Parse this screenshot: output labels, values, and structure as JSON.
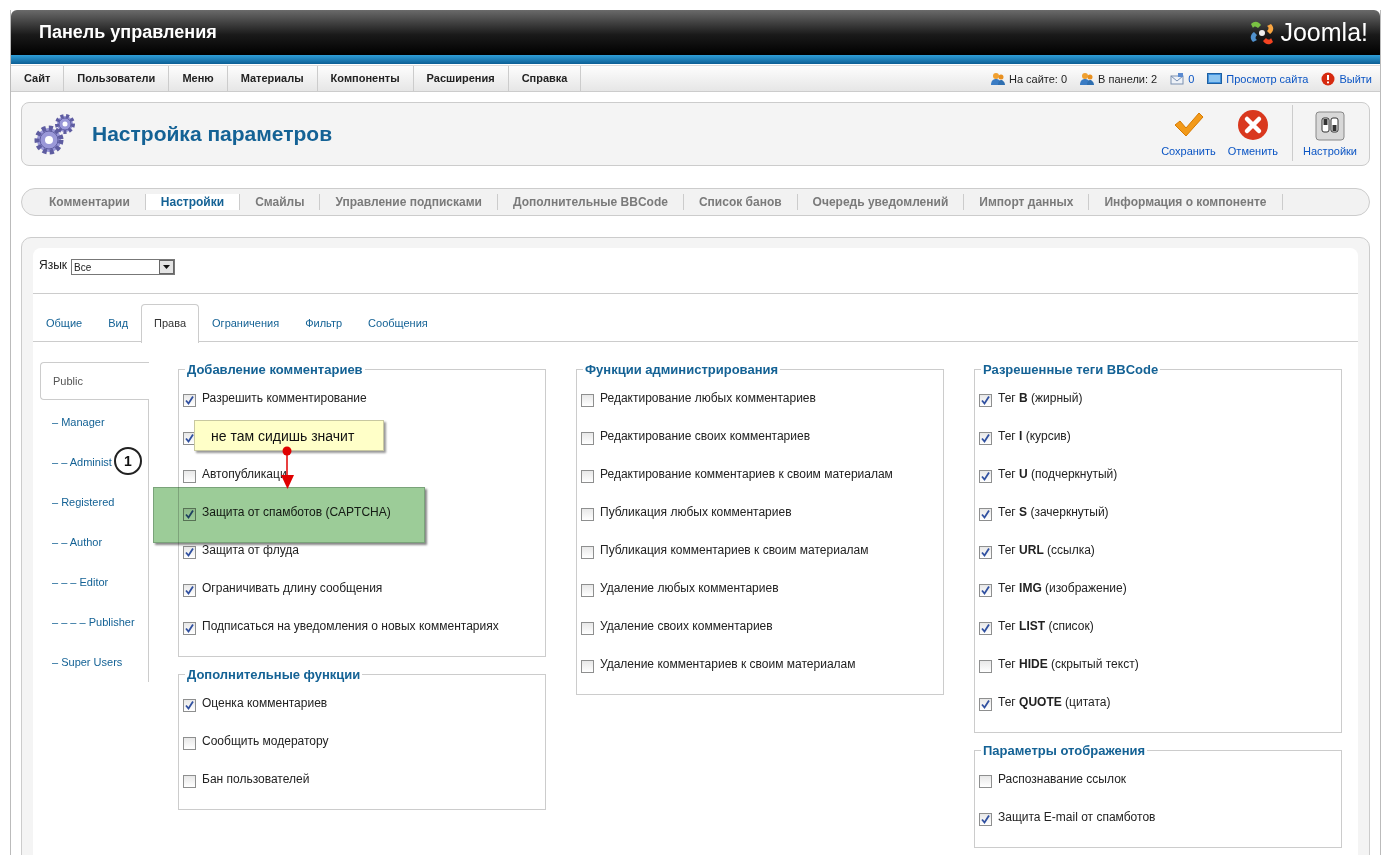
{
  "header": {
    "title": "Панель управления",
    "logo": "Joomla!"
  },
  "menu": [
    {
      "label": "Сайт"
    },
    {
      "label": "Пользователи"
    },
    {
      "label": "Меню"
    },
    {
      "label": "Материалы"
    },
    {
      "label": "Компоненты"
    },
    {
      "label": "Расширения"
    },
    {
      "label": "Справка"
    }
  ],
  "status": [
    {
      "kind": "users",
      "text": "На сайте: 0"
    },
    {
      "kind": "users",
      "text": "В панели: 2"
    },
    {
      "kind": "messages",
      "text": "0"
    },
    {
      "kind": "preview",
      "text": "Просмотр сайта"
    },
    {
      "kind": "logout",
      "text": "Выйти"
    }
  ],
  "toolbar": {
    "title": "Настройка параметров",
    "buttons": [
      {
        "kind": "save",
        "label": "Сохранить"
      },
      {
        "kind": "cancel",
        "label": "Отменить"
      },
      {
        "kind": "options",
        "label": "Настройки"
      }
    ]
  },
  "submenu": [
    {
      "label": "Комментарии",
      "selected": false
    },
    {
      "label": "Настройки",
      "selected": true
    },
    {
      "label": "Смайлы",
      "selected": false
    },
    {
      "label": "Управление подписками",
      "selected": false
    },
    {
      "label": "Дополнительные BBCode",
      "selected": false
    },
    {
      "label": "Список банов",
      "selected": false
    },
    {
      "label": "Очередь уведомлений",
      "selected": false
    },
    {
      "label": "Импорт данных",
      "selected": false
    },
    {
      "label": "Информация о компоненте",
      "selected": false
    }
  ],
  "language": {
    "label": "Язык",
    "value": "Все"
  },
  "tabs": [
    {
      "label": "Общие",
      "selected": false
    },
    {
      "label": "Вид",
      "selected": false
    },
    {
      "label": "Права",
      "selected": true
    },
    {
      "label": "Ограничения",
      "selected": false
    },
    {
      "label": "Фильтр",
      "selected": false
    },
    {
      "label": "Сообщения",
      "selected": false
    }
  ],
  "groups": [
    {
      "label": "Public",
      "selected": true,
      "children": [
        {
          "label": "– Manager",
          "selected": false,
          "children": [
            {
              "label": "– – Administ",
              "selected": false
            }
          ]
        },
        {
          "label": "– Registered",
          "selected": false,
          "children": [
            {
              "label": "– – Author",
              "selected": false,
              "children": [
                {
                  "label": "– – – Editor",
                  "selected": false,
                  "children": [
                    {
                      "label": "– – – – Publisher",
                      "selected": false
                    }
                  ]
                }
              ]
            }
          ]
        },
        {
          "label": "– Super Users",
          "selected": false
        }
      ]
    }
  ],
  "columns": [
    {
      "fieldsets": [
        {
          "legend": "Добавление комментариев",
          "items": [
            {
              "label": "Разрешить комментирование",
              "checked": true
            },
            {
              "checked": true
            },
            {
              "label": "Автопубликаци",
              "checked": false
            },
            {
              "label": "Защита от спамботов (CAPTCHA)",
              "checked": true
            },
            {
              "label": "Защита от флуда",
              "checked": true
            },
            {
              "label": "Ограничивать длину сообщения",
              "checked": true
            },
            {
              "label": "Подписаться на уведомления о новых комментариях",
              "checked": true
            }
          ]
        },
        {
          "legend": "Дополнительные функции",
          "items": [
            {
              "label": "Оценка комментариев",
              "checked": true
            },
            {
              "label": "Сообщить модератору",
              "checked": false
            },
            {
              "label": "Бан пользователей",
              "checked": false
            }
          ]
        }
      ]
    },
    {
      "fieldsets": [
        {
          "legend": "Функции администрирования",
          "items": [
            {
              "label": "Редактирование любых комментариев",
              "checked": false
            },
            {
              "label": "Редактирование своих комментариев",
              "checked": false
            },
            {
              "label": "Редактирование комментариев к своим материалам",
              "checked": false
            },
            {
              "label": "Публикация любых комментариев",
              "checked": false
            },
            {
              "label": "Публикация комментариев к своим материалам",
              "checked": false
            },
            {
              "label": "Удаление любых комментариев",
              "checked": false
            },
            {
              "label": "Удаление своих комментариев",
              "checked": false
            },
            {
              "label": "Удаление комментариев к своим материалам",
              "checked": false
            }
          ]
        }
      ]
    },
    {
      "fieldsets": [
        {
          "legend": "Разрешенные теги BBCode",
          "items": [
            {
              "label": "Тег **B** (жирный)",
              "checked": true
            },
            {
              "label": "Тег **I** (курсив)",
              "checked": true
            },
            {
              "label": "Тег **U** (подчеркнутый)",
              "checked": true
            },
            {
              "label": "Тег **S** (зачеркнутый)",
              "checked": true
            },
            {
              "label": "Тег **URL** (ссылка)",
              "checked": true
            },
            {
              "label": "Тег **IMG** (изображение)",
              "checked": true
            },
            {
              "label": "Тег **LIST** (список)",
              "checked": true
            },
            {
              "label": "Тег **HIDE** (скрытый текст)",
              "checked": false
            },
            {
              "label": "Тег **QUOTE** (цитата)",
              "checked": true
            }
          ]
        },
        {
          "legend": "Параметры отображения",
          "items": [
            {
              "label": "Распознавание ссылок",
              "checked": false
            },
            {
              "label": "Защита E-mail от спамботов",
              "checked": true
            }
          ]
        }
      ]
    }
  ],
  "annotations": {
    "callout": "не там сидишь значит",
    "marker": "1",
    "highlight": true
  }
}
